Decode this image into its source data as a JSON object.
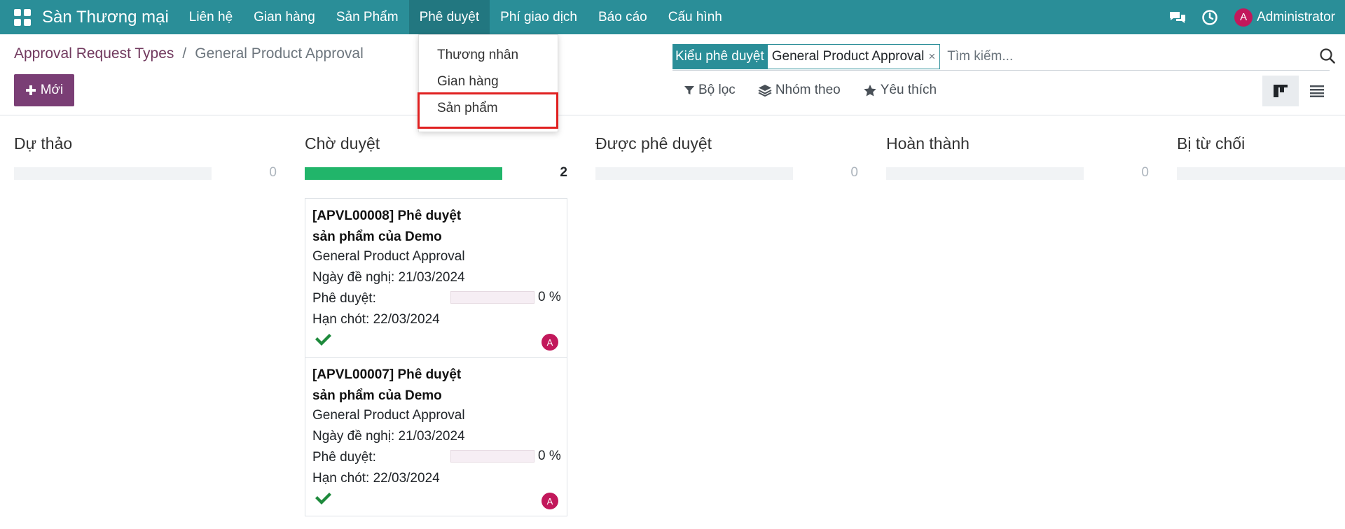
{
  "navbar": {
    "app_name": "Sàn Thương mại",
    "menu": [
      "Liên hệ",
      "Gian hàng",
      "Sản Phẩm",
      "Phê duyệt",
      "Phí giao dịch",
      "Báo cáo",
      "Cấu hình"
    ],
    "open_menu_index": 3,
    "user_initial": "A",
    "user_name": "Administrator",
    "icons": [
      "apps-icon",
      "chat-icon",
      "clock-icon"
    ]
  },
  "dropdown": {
    "items": [
      "Thương nhân",
      "Gian hàng",
      "Sản phẩm"
    ],
    "highlighted_index": 2
  },
  "breadcrumb": {
    "parent": "Approval Request Types",
    "separator": "/",
    "current": "General Product Approval"
  },
  "toolbar": {
    "new_label": "Mới"
  },
  "search": {
    "facet_label": "Kiểu phê duyệt",
    "facet_value": "General Product Approval",
    "facet_remove": "×",
    "placeholder": "Tìm kiếm..."
  },
  "filters": {
    "filter_label": "Bộ lọc",
    "group_label": "Nhóm theo",
    "favorite_label": "Yêu thích"
  },
  "columns": [
    {
      "title": "Dự thảo",
      "count": "0",
      "progress": 0
    },
    {
      "title": "Chờ duyệt",
      "count": "2",
      "progress": 1
    },
    {
      "title": "Được phê duyệt",
      "count": "0",
      "progress": 0
    },
    {
      "title": "Hoàn thành",
      "count": "0",
      "progress": 0
    },
    {
      "title": "Bị từ chối",
      "count": "",
      "progress": 0
    }
  ],
  "cards": [
    {
      "title": "[APVL00008] Phê duyệt sản phẩm của Demo",
      "type": "General Product Approval",
      "request_date": "Ngày đề nghị: 21/03/2024",
      "approval_label": "Phê duyệt:",
      "approval_pct": "0 %",
      "deadline": "Hạn chót: 22/03/2024",
      "avatar": "A"
    },
    {
      "title": "[APVL00007] Phê duyệt sản phẩm của Demo",
      "type": "General Product Approval",
      "request_date": "Ngày đề nghị: 21/03/2024",
      "approval_label": "Phê duyệt:",
      "approval_pct": "0 %",
      "deadline": "Hạn chót: 22/03/2024",
      "avatar": "A"
    }
  ],
  "colors": {
    "navbar": "#2a8e98",
    "primary": "#7a3e75",
    "success": "#21b56a",
    "highlight": "#e02020"
  }
}
